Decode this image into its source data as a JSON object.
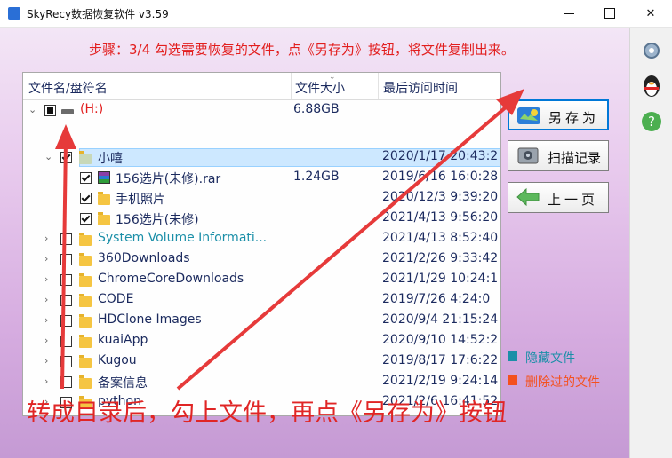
{
  "window": {
    "title": "SkyRecy数据恢复软件 v3.59"
  },
  "step_text": "步骤：3/4 勾选需要恢复的文件，点《另存为》按钮，将文件复制出来。",
  "tree": {
    "columns": [
      "文件名/盘符名",
      "文件大小",
      "最后访问时间"
    ],
    "rows": [
      {
        "name": "(H:)",
        "size": "6.88GB",
        "time": ""
      },
      {
        "name": "小嘻",
        "size": "",
        "time": "2020/1/17 20:43:2"
      },
      {
        "name": "156选片(未修).rar",
        "size": "1.24GB",
        "time": "2019/6/16 16:0:28"
      },
      {
        "name": "手机照片",
        "size": "",
        "time": "2020/12/3 9:39:20"
      },
      {
        "name": "156选片(未修)",
        "size": "",
        "time": "2021/4/13 9:56:20"
      },
      {
        "name": "System Volume Informati...",
        "size": "",
        "time": "2021/4/13 8:52:40"
      },
      {
        "name": "360Downloads",
        "size": "",
        "time": "2021/2/26 9:33:42"
      },
      {
        "name": "ChromeCoreDownloads",
        "size": "",
        "time": "2021/1/29 10:24:1"
      },
      {
        "name": "CODE",
        "size": "",
        "time": "2019/7/26 4:24:0"
      },
      {
        "name": "HDClone Images",
        "size": "",
        "time": "2020/9/4 21:15:24"
      },
      {
        "name": "kuaiApp",
        "size": "",
        "time": "2020/9/10 14:52:2"
      },
      {
        "name": "Kugou",
        "size": "",
        "time": "2019/8/17 17:6:22"
      },
      {
        "name": "备案信息",
        "size": "",
        "time": "2021/2/19 9:24:14"
      },
      {
        "name": "python",
        "size": "",
        "time": "2021/2/6 16:41:52"
      }
    ]
  },
  "buttons": {
    "save_as": "另存为",
    "scan_history": "扫描记录",
    "previous": "上一页"
  },
  "legend": {
    "hidden_files": "隐藏文件",
    "deleted_files": "删除过的文件"
  },
  "instruction": "转成目录后，勾上文件，再点《另存为》按钮",
  "colors": {
    "step_text": "#e21e1e",
    "drive_label": "#e21e1e",
    "hidden_item": "#1b8fa8",
    "normal_item": "#1b2a5e",
    "hidden_swatch": "#1b8fa8",
    "deleted_swatch": "#f4511e",
    "arrow": "#e63a3a"
  }
}
